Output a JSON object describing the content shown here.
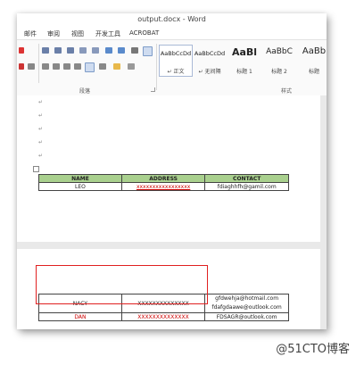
{
  "window": {
    "title": "output.docx - Word"
  },
  "menu": {
    "items": [
      "邮件",
      "审阅",
      "视图",
      "开发工具",
      "ACROBAT"
    ]
  },
  "ribbon": {
    "styles": [
      {
        "sample": "AaBbCcDd",
        "name": "↵ 正文",
        "selected": true
      },
      {
        "sample": "AaBbCcDd",
        "name": "↵ 无间隔",
        "selected": false
      },
      {
        "sample": "AaBl",
        "name": "标题 1",
        "selected": false
      },
      {
        "sample": "AaBbC",
        "name": "标题 2",
        "selected": false
      },
      {
        "sample": "AaBb",
        "name": "标题",
        "selected": false
      }
    ],
    "groups": {
      "paragraph": "段落",
      "styles": "样式"
    }
  },
  "document": {
    "paragraph_mark": "↵",
    "table1": {
      "headers": [
        "NAME",
        "ADDRESS",
        "CONTACT"
      ],
      "rows": [
        [
          "LEO",
          "xxxxxxxxxxxxxxxxx",
          "fdiaghhfh@gamil.com"
        ]
      ]
    },
    "table2": {
      "rows": [
        [
          "NACY",
          "XXXXXXXXXXXXXX",
          "gfdwehja@hotmail.com",
          "fdafgdaawe@outlook.com"
        ],
        [
          "DAN",
          "XXXXXXXXXXXXXX",
          "FDSAGR@outlook.com"
        ]
      ]
    },
    "accent_color": "#a9d08e",
    "highlight_color": "#e02020"
  },
  "watermark": "@51CTO博客"
}
